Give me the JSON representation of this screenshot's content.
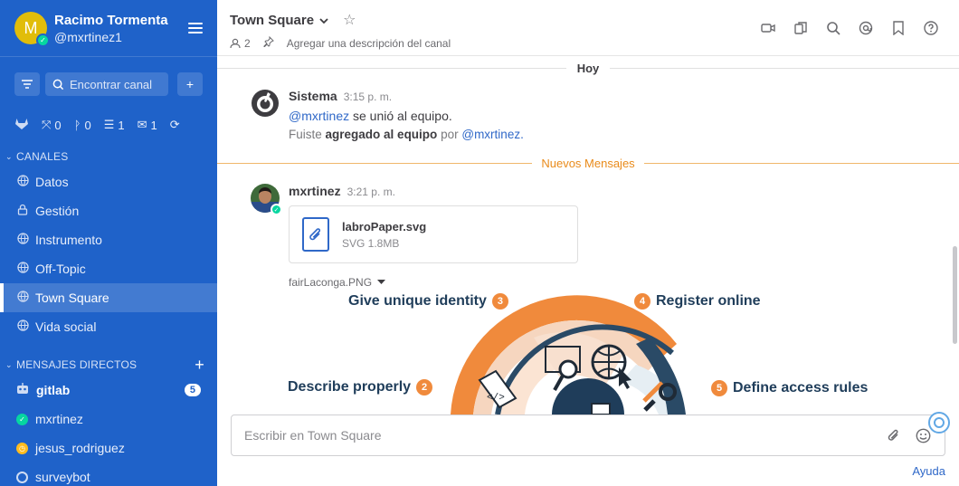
{
  "sidebar": {
    "user": {
      "initial": "M",
      "name": "Racimo Tormenta",
      "handle": "@mxrtinez1"
    },
    "search_placeholder": "Encontrar canal",
    "plugins": [
      {
        "icon": "merge-icon",
        "count": "0"
      },
      {
        "icon": "branch-icon",
        "count": "0"
      },
      {
        "icon": "list-icon",
        "count": "1"
      },
      {
        "icon": "mail-icon",
        "count": "1"
      }
    ],
    "channels_label": "CANALES",
    "channels": [
      {
        "label": "Datos",
        "icon": "globe-icon"
      },
      {
        "label": "Gestión",
        "icon": "lock-icon"
      },
      {
        "label": "Instrumento",
        "icon": "globe-icon"
      },
      {
        "label": "Off-Topic",
        "icon": "globe-icon"
      },
      {
        "label": "Town Square",
        "icon": "globe-icon",
        "active": true
      },
      {
        "label": "Vida social",
        "icon": "globe-icon"
      }
    ],
    "dm_label": "MENSAJES DIRECTOS",
    "dms": [
      {
        "label": "gitlab",
        "badge": "5"
      },
      {
        "label": "mxrtinez"
      },
      {
        "label": "jesus_rodriguez"
      },
      {
        "label": "surveybot"
      }
    ]
  },
  "channel": {
    "title": "Town Square",
    "members": "2",
    "description": "Agregar una descripción del canal"
  },
  "feed": {
    "date": "Hoy",
    "new_messages": "Nuevos Mensajes",
    "system_post": {
      "author": "Sistema",
      "time": "3:15 p. m.",
      "line1_mention": "@mxrtinez",
      "line1_text": "se unió al equipo.",
      "line2_a": "Fuiste",
      "line2_b": "agregado al equipo",
      "line2_c": "por",
      "line2_mention": "@mxrtinez."
    },
    "user_post": {
      "author": "mxrtinez",
      "time": "3:21 p. m.",
      "file_name": "labroPaper.svg",
      "file_meta": "SVG 1.8MB",
      "image_name": "fairLaconga.PNG"
    },
    "preview": {
      "labels": [
        {
          "text": "Give unique identity",
          "num": "3"
        },
        {
          "text": "Register online",
          "num": "4"
        },
        {
          "text": "Describe properly",
          "num": "2"
        },
        {
          "text": "Define access rules",
          "num": "5"
        }
      ]
    }
  },
  "composer": {
    "placeholder": "Escribir en Town Square"
  },
  "help": "Ayuda",
  "colors": {
    "sidebar": "#1f62c9",
    "accent": "#2f68c8",
    "new": "#e98b1b",
    "online": "#06d6a0",
    "away": "#ffbc1f"
  }
}
